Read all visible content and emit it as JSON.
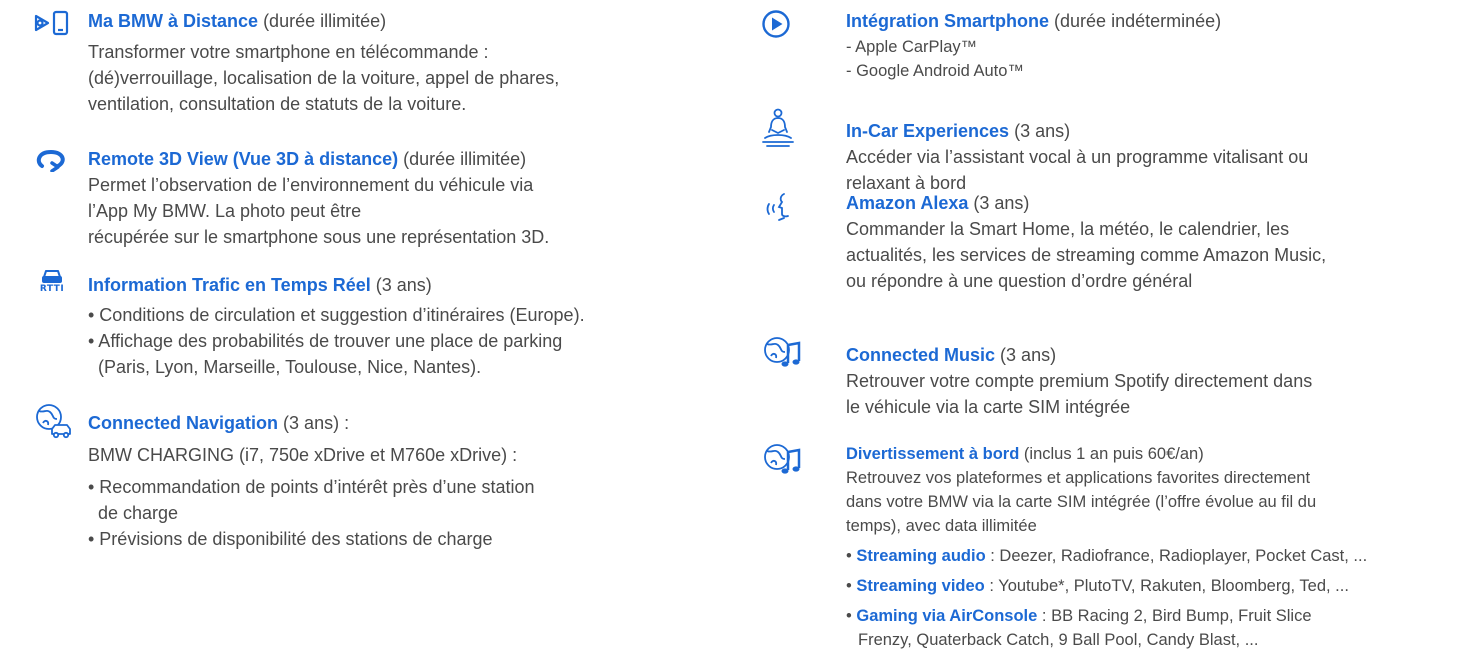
{
  "left": {
    "ma_bmw": {
      "title": "Ma BMW à Distance",
      "duration": "(durée illimitée)",
      "lines": [
        "Transformer votre smartphone en télécommande :",
        "(dé)verrouillage, localisation de la voiture, appel de phares,",
        "ventilation, consultation de statuts de la voiture."
      ]
    },
    "remote3d": {
      "title": "Remote 3D View (Vue 3D à distance)",
      "duration": "(durée illimitée)",
      "lines": [
        "Permet l’observation de l’environnement du véhicule via",
        "l’App My BMW. La photo peut être",
        "récupérée sur le smartphone sous une représentation 3D."
      ]
    },
    "rtti": {
      "icon_label": "RTTI",
      "title": "Information Trafic en Temps Réel",
      "duration": "(3 ans)",
      "bullets": [
        "• Conditions de circulation et suggestion d’itinéraires (Europe).",
        "• Affichage des probabilités de trouver une place de parking",
        "  (Paris, Lyon, Marseille, Toulouse, Nice, Nantes)."
      ]
    },
    "navigation": {
      "title": "Connected Navigation",
      "duration": "(3 ans) :",
      "intro": "BMW CHARGING (i7, 750e xDrive et M760e xDrive) :",
      "bullets": [
        "• Recommandation de points d’intérêt près d’une station",
        "  de charge",
        "• Prévisions de disponibilité des stations de charge"
      ]
    }
  },
  "right": {
    "smartphone": {
      "title": "Intégration Smartphone",
      "duration": "(durée indéterminée)",
      "lines": [
        "- Apple CarPlay™",
        "- Google Android Auto™"
      ]
    },
    "incar": {
      "title": "In-Car Experiences",
      "duration": "(3 ans)",
      "lines": [
        "Accéder via l’assistant vocal à un programme vitalisant ou",
        "relaxant à bord"
      ]
    },
    "alexa": {
      "title": "Amazon Alexa",
      "duration": "(3 ans)",
      "lines": [
        "Commander la Smart Home, la météo, le calendrier, les",
        "actualités, les services de streaming comme Amazon Music,",
        "ou répondre à une question d’ordre général"
      ]
    },
    "music": {
      "title": "Connected Music",
      "duration": "(3 ans)",
      "lines": [
        "Retrouver votre compte premium Spotify directement dans",
        "le véhicule via la carte SIM intégrée"
      ]
    },
    "divert": {
      "title": "Divertissement à bord",
      "duration": "(inclus 1 an puis 60€/an)",
      "lines": [
        "Retrouvez vos plateformes et applications favorites directement",
        "dans votre BMW via la carte SIM intégrée (l’offre évolue au fil du",
        "temps), avec data illimitée"
      ],
      "bullets": [
        {
          "label": "Streaming audio",
          "text": " : Deezer, Radiofrance, Radioplayer, Pocket Cast, ..."
        },
        {
          "label": "Streaming video",
          "text": " : Youtube*, PlutoTV, Rakuten, Bloomberg, Ted, ..."
        },
        {
          "label": "Gaming via AirConsole",
          "text": " : BB Racing 2, Bird Bump, Fruit Slice"
        }
      ],
      "continuation": "Frenzy, Quaterback Catch, 9 Ball Pool, Candy Blast, ..."
    }
  }
}
